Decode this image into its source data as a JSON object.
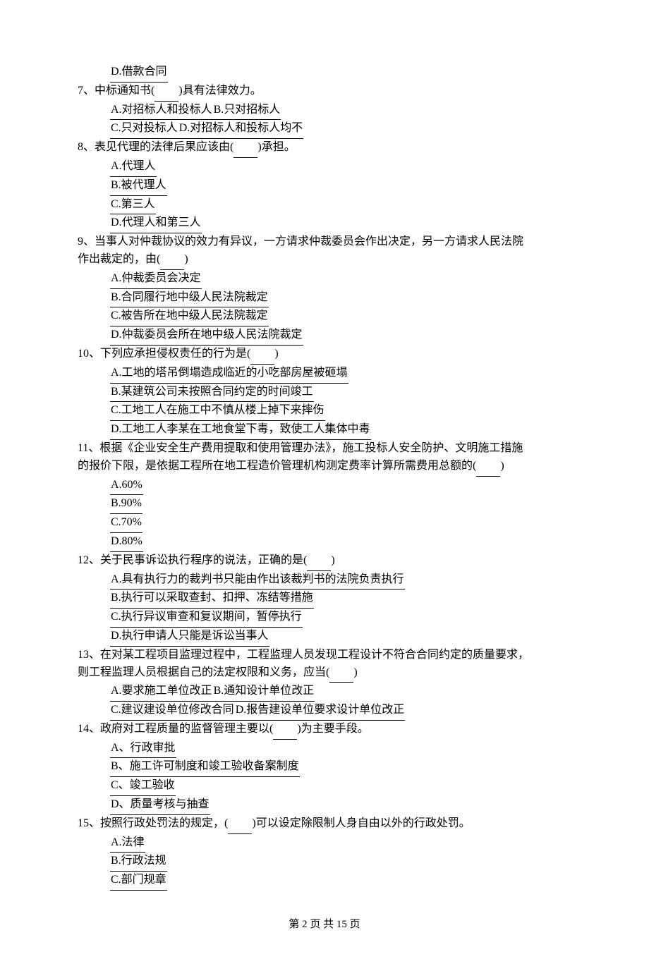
{
  "q6": {
    "D": "D.借款合同"
  },
  "q7": {
    "stem_a": "7、中标通知书(",
    "stem_b": ")具有法律效力。",
    "A": "A.对招标人和投标人",
    "B": "B.只对招标人",
    "C": "C.只对投标人",
    "D": "D.对招标人和投标人均不"
  },
  "q8": {
    "stem_a": "8、表见代理的法律后果应该由(",
    "stem_b": ")承担。",
    "A": "A.代理人",
    "B": "B.被代理人",
    "C": "C.第三人",
    "D": "D.代理人和第三人"
  },
  "q9": {
    "stem1": "9、当事人对仲裁协议的效力有异议，一方请求仲裁委员会作出决定，另一方请求人民法院",
    "stem2a": "作出裁定的，由(",
    "stem2b": ")",
    "A": "A.仲裁委员会决定",
    "B": "B.合同履行地中级人民法院裁定",
    "C": "C.被告所在地中级人民法院裁定",
    "D": "D.仲裁委员会所在地中级人民法院裁定"
  },
  "q10": {
    "stem_a": "10、下列应承担侵权责任的行为是(",
    "stem_b": ")",
    "A": "A.工地的塔吊倒塌造成临近的小吃部房屋被砸塌",
    "B": "B.某建筑公司未按照合同约定的时间竣工",
    "C": "C.工地工人在施工中不慎从楼上掉下来摔伤",
    "D": "D.工地工人李某在工地食堂下毒，致使工人集体中毒"
  },
  "q11": {
    "stem1": "11、根据《企业安全生产费用提取和使用管理办法》，施工投标人安全防护、文明施工措施",
    "stem2a": "的报价下限，是依据工程所在地工程造价管理机构测定费率计算所需费用总额的(",
    "stem2b": ")",
    "A": "A.60%",
    "B": "B.90%",
    "C": "C.70%",
    "D": "D.80%"
  },
  "q12": {
    "stem_a": "12、关于民事诉讼执行程序的说法，正确的是(",
    "stem_b": ")",
    "A": "A.具有执行力的裁判书只能由作出该裁判书的法院负责执行",
    "B": "B.执行可以采取查封、扣押、冻结等措施",
    "C": "C.执行异议审查和复议期间，暂停执行",
    "D": "D.执行申请人只能是诉讼当事人"
  },
  "q13": {
    "stem1": "13、在对某工程项目监理过程中，工程监理人员发现工程设计不符合合同约定的质量要求，",
    "stem2a": "则工程监理人员根据自己的法定权限和义务，应当(",
    "stem2b": ")",
    "A": "A.要求施工单位改正",
    "B": "B.通知设计单位改正",
    "C": "C.建议建设单位修改合同",
    "D": "D.报告建设单位要求设计单位改正"
  },
  "q14": {
    "stem_a": "14、政府对工程质量的监督管理主要以(",
    "stem_b": ")为主要手段。",
    "A": "A、行政审批",
    "B": "B、施工许可制度和竣工验收备案制度",
    "C": "C、竣工验收",
    "D": "D、质量考核与抽查"
  },
  "q15": {
    "stem_a": "15、按照行政处罚法的规定，(",
    "stem_b": ")可以设定除限制人身自由以外的行政处罚。",
    "A": "A.法律",
    "B": "B.行政法规",
    "C": "C.部门规章"
  },
  "footer": "第 2 页 共 15 页",
  "blank": "　　"
}
